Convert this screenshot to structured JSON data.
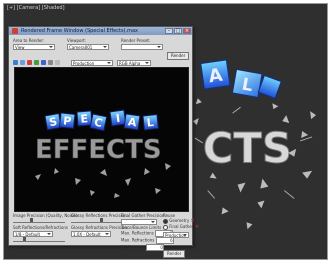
{
  "viewport": {
    "label": "[+] [Camera] [Shaded]"
  },
  "dialog": {
    "title": "Rendered Frame Window (Special Effects).max",
    "fields": [
      {
        "label": "Area to Render:",
        "value": "View"
      },
      {
        "label": "Viewport:",
        "value": "Camera001"
      },
      {
        "label": "Render Preset:",
        "value": ""
      }
    ],
    "render_button": "Render",
    "production_label": "Production",
    "channel_select": "RGB Alpha",
    "scene_text_top": "SPECIAL",
    "scene_text_bottom": "EFFECTS",
    "bottom": {
      "col1": {
        "heading": "Image Precision (Quality, Noise):",
        "slider_value": 0.35,
        "sub": "Soft Reflections/Refractions",
        "value": "1/8 - Default"
      },
      "col2": {
        "heading": "Glossy Reflections Precision:",
        "slider_value": 0.6,
        "sub": "Glossy Refractions Precision:",
        "value": "1.0X - Default"
      },
      "col3": {
        "heading": "Final Gather Precision:",
        "sub1": "Trace/Bounce Limits",
        "max_reflections": "Max. Reflections",
        "max_refractions": "Max. Refractions",
        "fg_bounces": "FG Bounces",
        "val1": "6",
        "val2": "6",
        "val3": "0"
      },
      "col4": {
        "reuse": "Reuse",
        "geometry": "Geometry",
        "final_gather": "Final Gather",
        "production": "Production",
        "render": "Render"
      }
    }
  },
  "colors": {
    "cube_blue": "#2f49d6",
    "cube_cyan": "#3fb6e0",
    "metal": "#c8c8c8"
  }
}
